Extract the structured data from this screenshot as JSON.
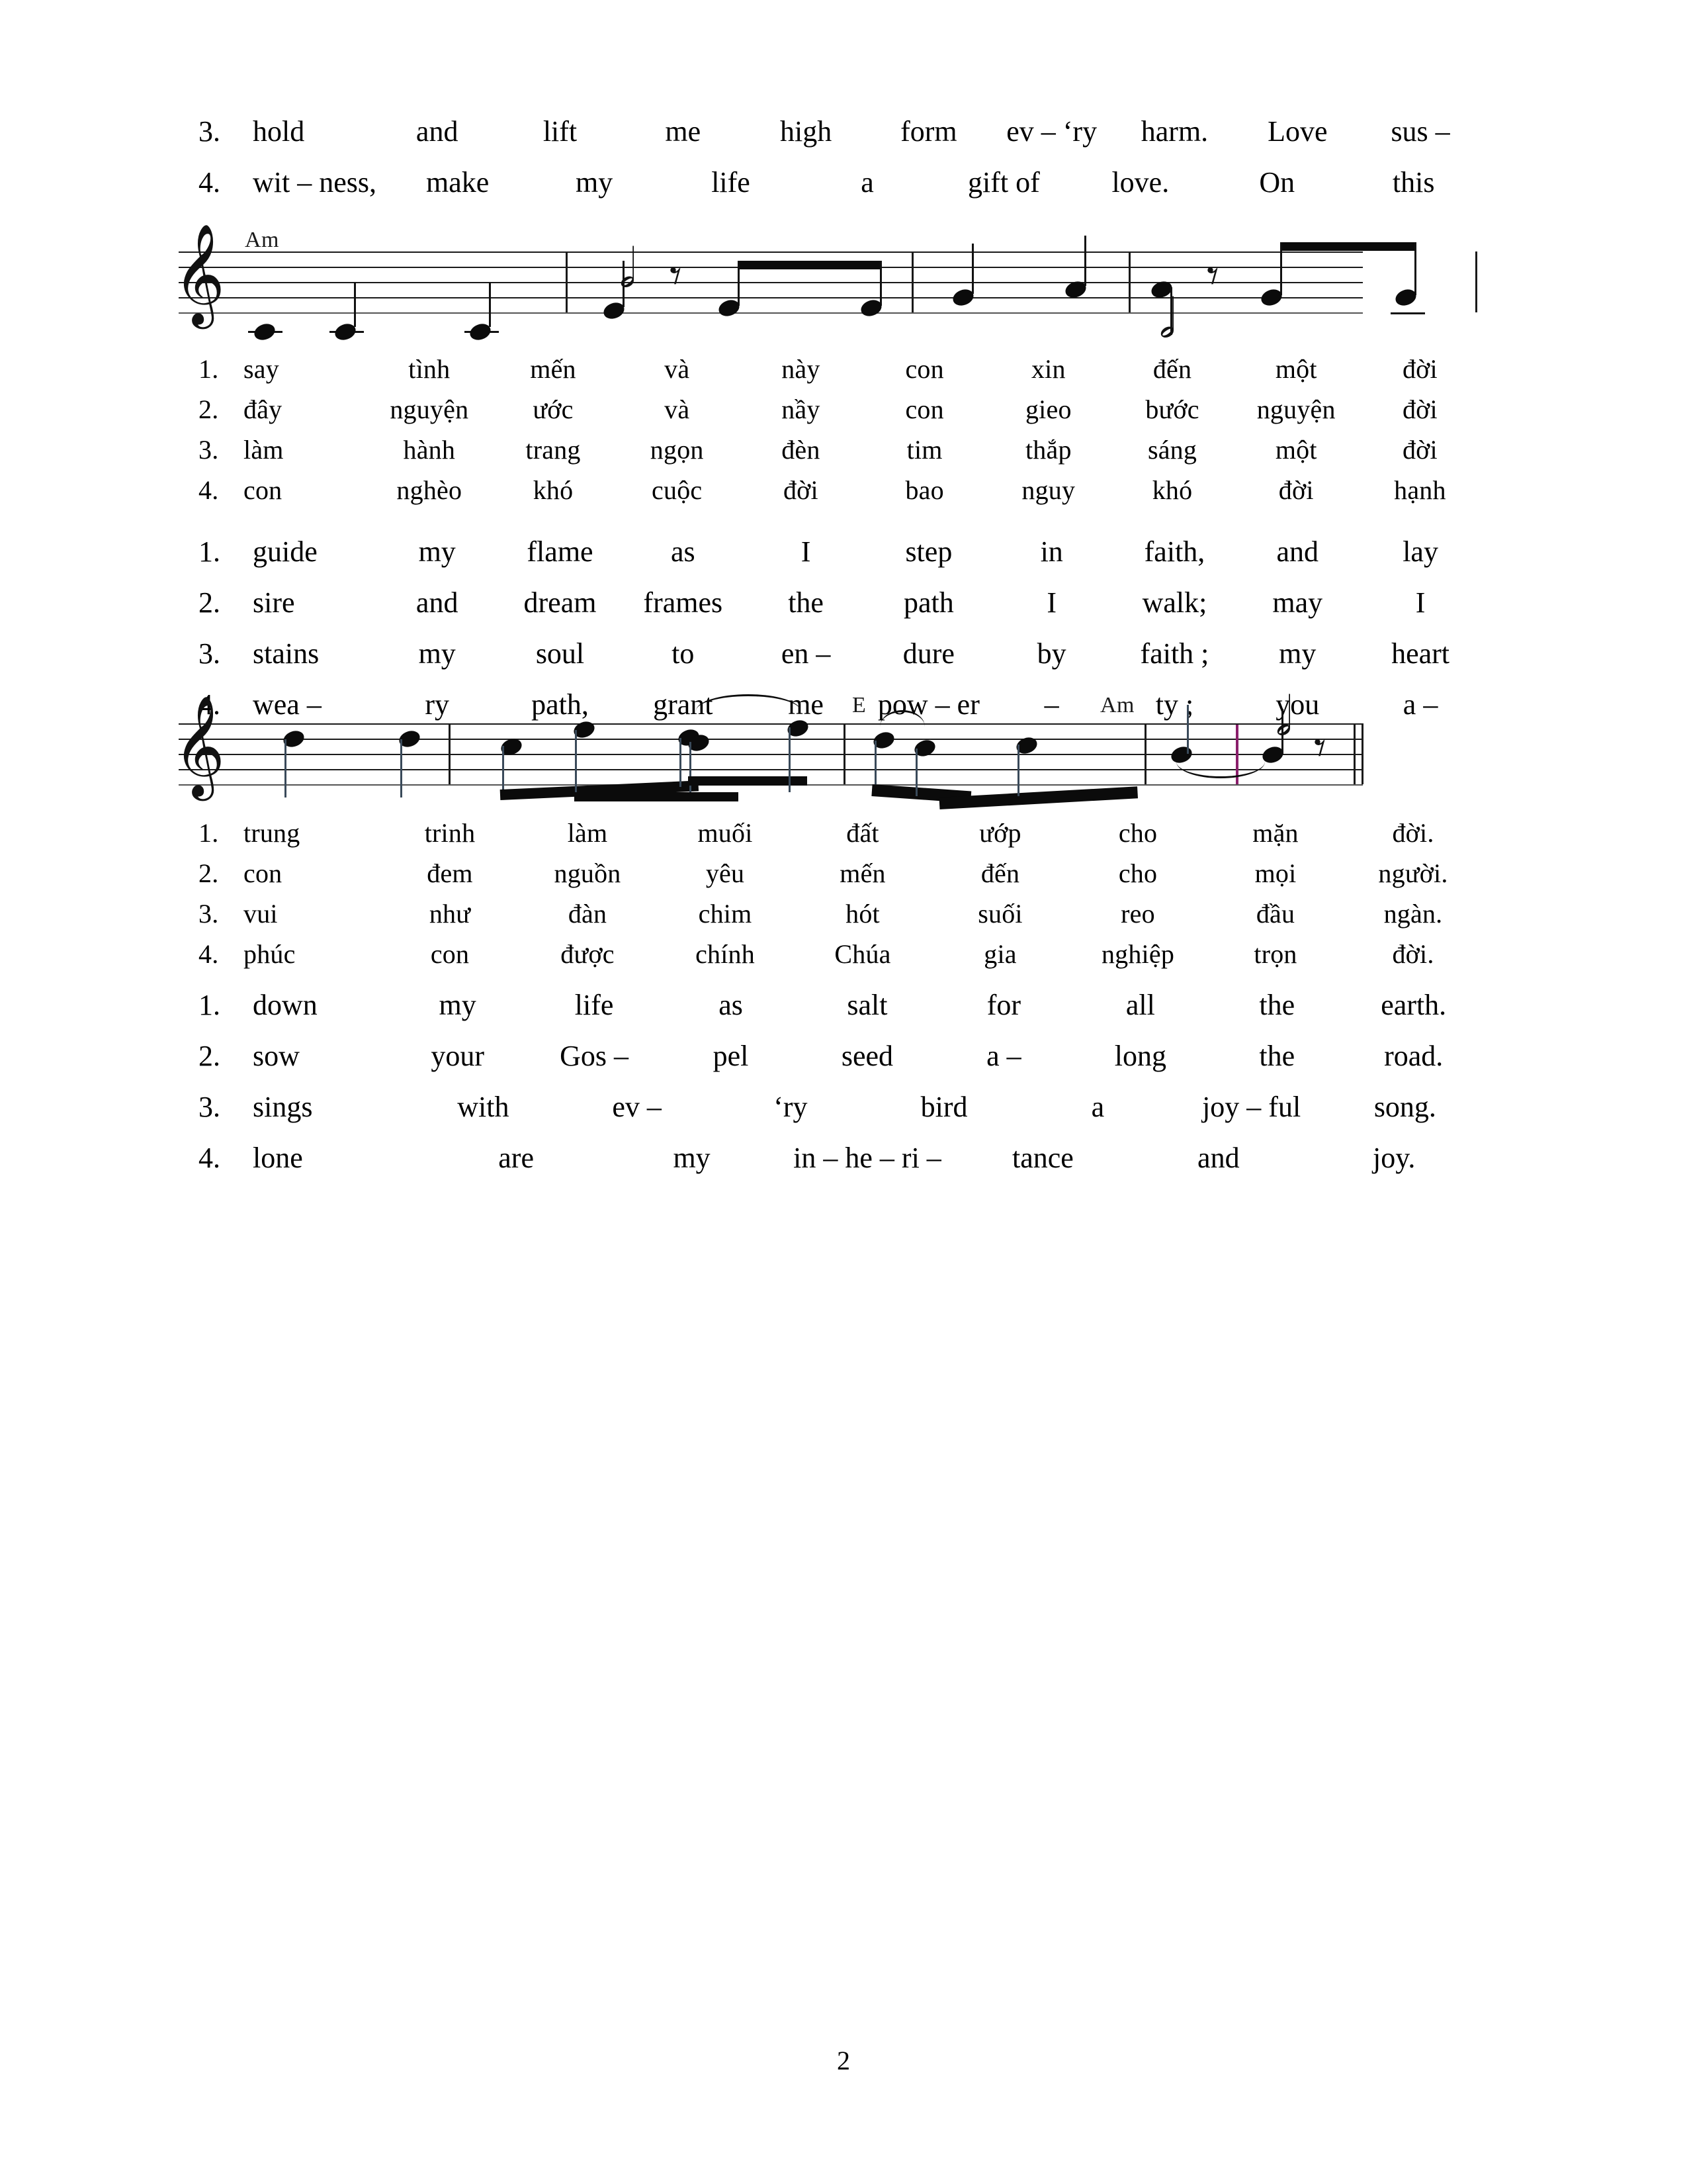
{
  "document": {
    "page_number": "2",
    "chord_symbols": [
      "Am",
      "E",
      "Am"
    ]
  },
  "lyrics_top": {
    "lines": [
      {
        "verse": "3.",
        "syllables": [
          "hold",
          "and",
          "lift",
          "me",
          "high",
          "form",
          "ev – ‘ry",
          "harm.",
          "Love",
          "sus –"
        ]
      },
      {
        "verse": "4.",
        "syllables": [
          "wit – ness,",
          "make",
          "my",
          "life",
          "a",
          "gift of",
          "love.",
          "On",
          "this"
        ]
      }
    ]
  },
  "staff_one": {
    "chord": "Am",
    "clef": "treble-clef"
  },
  "lyrics_vn_1": {
    "lines": [
      {
        "verse": "1.",
        "syllables": [
          "say",
          "tình",
          "mến",
          "và",
          "này",
          "con",
          "xin",
          "đến",
          "một",
          "đời"
        ]
      },
      {
        "verse": "2.",
        "syllables": [
          "đây",
          "nguyện",
          "ước",
          "và",
          "nầy",
          "con",
          "gieo",
          "bước",
          "nguyện",
          "đời"
        ]
      },
      {
        "verse": "3.",
        "syllables": [
          "làm",
          "hành",
          "trang",
          "ngọn",
          "đèn",
          "tim",
          "thắp",
          "sáng",
          "một",
          "đời"
        ]
      },
      {
        "verse": "4.",
        "syllables": [
          "con",
          "nghèo",
          "khó",
          "cuộc",
          "đời",
          "bao",
          "nguy",
          "khó",
          "đời",
          "hạnh"
        ]
      }
    ]
  },
  "lyrics_en_1": {
    "lines": [
      {
        "verse": "1.",
        "syllables": [
          "guide",
          "my",
          "flame",
          "as",
          "I",
          "step",
          "in",
          "faith,",
          "and",
          "lay"
        ]
      },
      {
        "verse": "2.",
        "syllables": [
          "sire",
          "and",
          "dream",
          "frames",
          "the",
          "path",
          "I",
          "walk;",
          "may",
          "I"
        ]
      },
      {
        "verse": "3.",
        "syllables": [
          "stains",
          "my",
          "soul",
          "to",
          "en –",
          "dure",
          "by",
          "faith ;",
          "my",
          "heart"
        ]
      },
      {
        "verse": "4.",
        "syllables": [
          "wea –",
          "ry",
          "path,",
          "grant",
          "me",
          "pow – er",
          "–",
          "ty ;",
          "you",
          "a –"
        ]
      }
    ]
  },
  "staff_two": {
    "chord_mid": "E",
    "chord_end": "Am",
    "clef": "treble-clef"
  },
  "lyrics_vn_2": {
    "lines": [
      {
        "verse": "1.",
        "syllables": [
          "trung",
          "trinh",
          "làm",
          "muối",
          "đất",
          "ướp",
          "cho",
          "mặn",
          "đời."
        ]
      },
      {
        "verse": "2.",
        "syllables": [
          "con",
          "đem",
          "nguồn",
          "yêu",
          "mến",
          "đến",
          "cho",
          "mọi",
          "người."
        ]
      },
      {
        "verse": "3.",
        "syllables": [
          "vui",
          "như",
          "đàn",
          "chim",
          "hót",
          "suối",
          "reo",
          "đầu",
          "ngàn."
        ]
      },
      {
        "verse": "4.",
        "syllables": [
          "phúc",
          "con",
          "được",
          "chính",
          "Chúa",
          "gia",
          "nghiệp",
          "trọn",
          "đời."
        ]
      }
    ]
  },
  "lyrics_en_2": {
    "lines": [
      {
        "verse": "1.",
        "syllables": [
          "down",
          "my",
          "life",
          "as",
          "salt",
          "for",
          "all",
          "the",
          "earth."
        ]
      },
      {
        "verse": "2.",
        "syllables": [
          "sow",
          "your",
          "Gos –",
          "pel",
          "seed",
          "a –",
          "long",
          "the",
          "road."
        ]
      },
      {
        "verse": "3.",
        "syllables": [
          "sings",
          "with",
          "ev –",
          "‘ry",
          "bird",
          "a",
          "joy – ful",
          "song."
        ]
      },
      {
        "verse": "4.",
        "syllables": [
          "lone",
          "are",
          "my",
          "in – he – ri –",
          "tance",
          "and",
          "joy."
        ]
      }
    ]
  }
}
